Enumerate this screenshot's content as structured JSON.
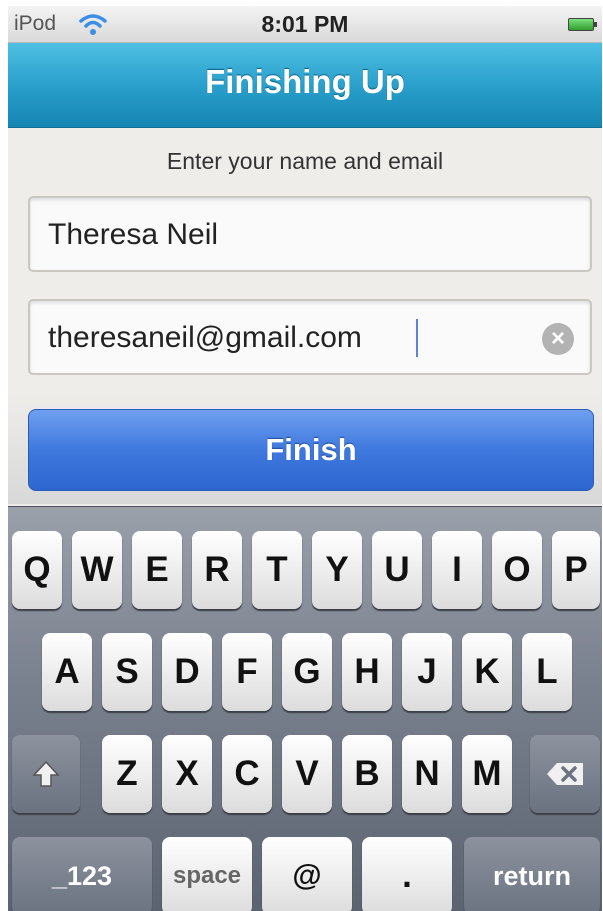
{
  "status_bar": {
    "carrier": "iPod",
    "time": "8:01 PM"
  },
  "nav": {
    "title": "Finishing Up"
  },
  "form": {
    "prompt": "Enter your name and email",
    "name_value": "Theresa Neil",
    "email_value": "theresaneil@gmail.com",
    "finish_label": "Finish"
  },
  "keyboard": {
    "row1": [
      "Q",
      "W",
      "E",
      "R",
      "T",
      "Y",
      "U",
      "I",
      "O",
      "P"
    ],
    "row2": [
      "A",
      "S",
      "D",
      "F",
      "G",
      "H",
      "J",
      "K",
      "L"
    ],
    "row3": [
      "Z",
      "X",
      "C",
      "V",
      "B",
      "N",
      "M"
    ],
    "numbers_label": "_123",
    "space_label": "space",
    "at_label": "@",
    "dot_label": ".",
    "return_label": "return"
  },
  "colors": {
    "nav_blue": "#2aa0cc",
    "finish_blue": "#3f79de"
  }
}
